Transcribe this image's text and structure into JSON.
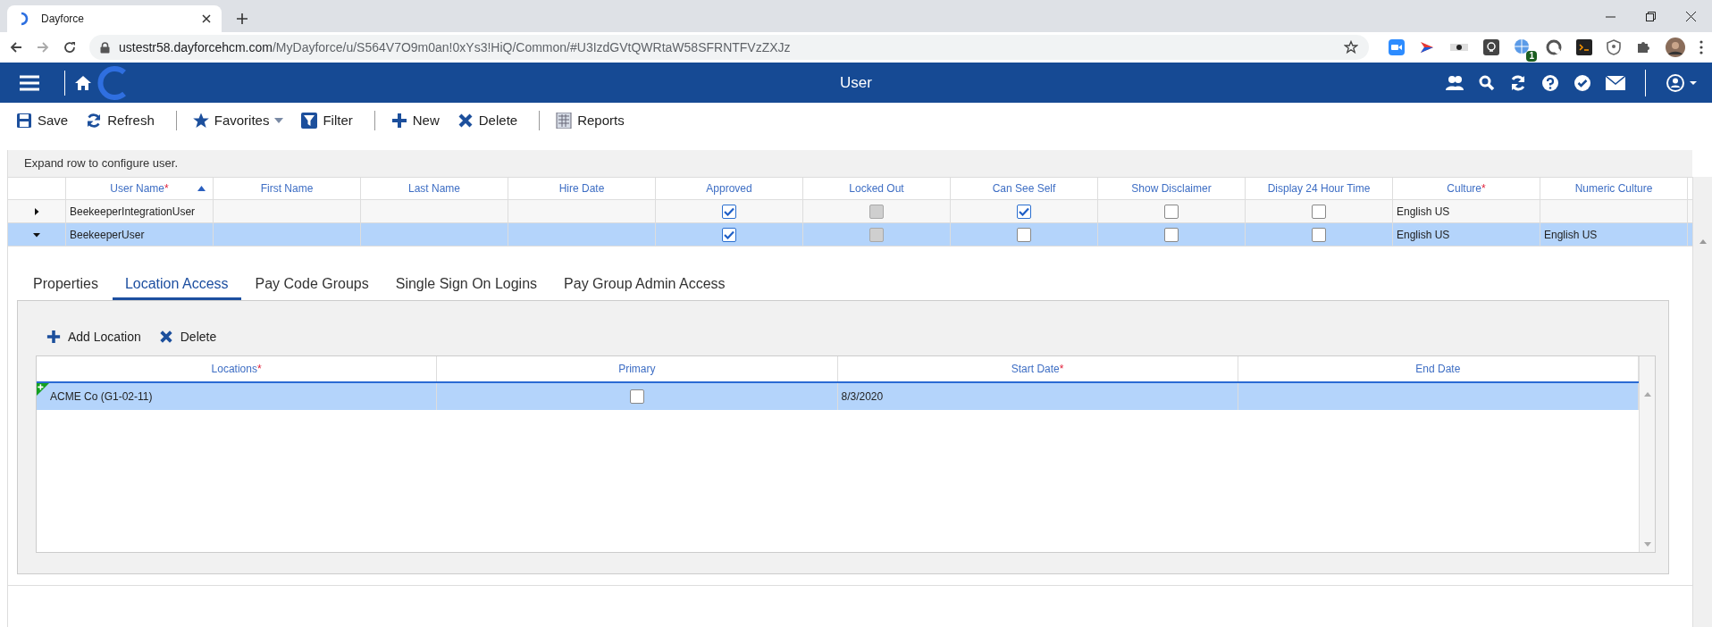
{
  "browser": {
    "tab_title": "Dayforce",
    "url_host": "ustestr58.dayforcehcm.com",
    "url_path": "/MyDayforce/u/S564V7O9m0an!0xYs3!HiQ/Common/#U3IzdGVtQWRtaW58SFRNTFVzZXJz",
    "extension_badge": "1"
  },
  "app": {
    "title": "User"
  },
  "toolbar": [
    {
      "kind": "save",
      "label": "Save"
    },
    {
      "kind": "refresh",
      "label": "Refresh"
    },
    {
      "kind": "separator"
    },
    {
      "kind": "favorites",
      "label": "Favorites"
    },
    {
      "kind": "filter",
      "label": "Filter"
    },
    {
      "kind": "separator"
    },
    {
      "kind": "new",
      "label": "New"
    },
    {
      "kind": "delete",
      "label": "Delete"
    },
    {
      "kind": "separator"
    },
    {
      "kind": "reports",
      "label": "Reports"
    }
  ],
  "hint": "Expand row to configure user.",
  "grid": {
    "columns": [
      {
        "label": "User Name",
        "required_mark": "*",
        "sorted": true
      },
      {
        "label": "First Name"
      },
      {
        "label": "Last Name"
      },
      {
        "label": "Hire Date"
      },
      {
        "label": "Approved"
      },
      {
        "label": "Locked Out"
      },
      {
        "label": "Can See Self"
      },
      {
        "label": "Show Disclaimer"
      },
      {
        "label": "Display 24 Hour Time"
      },
      {
        "label": "Culture",
        "required_mark": "*"
      },
      {
        "label": "Numeric Culture"
      }
    ],
    "rows": [
      {
        "expanded": false,
        "selected": false,
        "cells": [
          {
            "kind": "text",
            "text": "BeekeeperIntegrationUser"
          },
          {
            "kind": "empty"
          },
          {
            "kind": "empty"
          },
          {
            "kind": "empty"
          },
          {
            "kind": "checkbox",
            "checked": true,
            "disabled": false
          },
          {
            "kind": "checkbox",
            "checked": false,
            "disabled": true
          },
          {
            "kind": "checkbox",
            "checked": true,
            "disabled": false
          },
          {
            "kind": "checkbox",
            "checked": false,
            "disabled": false
          },
          {
            "kind": "checkbox",
            "checked": false,
            "disabled": false
          },
          {
            "kind": "text",
            "text": "English US"
          },
          {
            "kind": "empty"
          }
        ]
      },
      {
        "expanded": true,
        "selected": true,
        "cells": [
          {
            "kind": "text",
            "text": "BeekeeperUser"
          },
          {
            "kind": "empty"
          },
          {
            "kind": "empty"
          },
          {
            "kind": "empty"
          },
          {
            "kind": "checkbox",
            "checked": true,
            "disabled": false
          },
          {
            "kind": "checkbox",
            "checked": false,
            "disabled": true
          },
          {
            "kind": "checkbox",
            "checked": false,
            "disabled": false
          },
          {
            "kind": "checkbox",
            "checked": false,
            "disabled": false
          },
          {
            "kind": "checkbox",
            "checked": false,
            "disabled": false
          },
          {
            "kind": "text",
            "text": "English US"
          },
          {
            "kind": "text",
            "text": "English US"
          }
        ]
      }
    ]
  },
  "detail_tabs": [
    {
      "label": "Properties",
      "selected": false
    },
    {
      "label": "Location Access",
      "selected": true
    },
    {
      "label": "Pay Code Groups",
      "selected": false
    },
    {
      "label": "Single Sign On Logins",
      "selected": false
    },
    {
      "label": "Pay Group Admin Access",
      "selected": false
    }
  ],
  "detail_toolbar": [
    {
      "kind": "new",
      "label": "Add Location"
    },
    {
      "kind": "delete",
      "label": "Delete"
    }
  ],
  "locations": {
    "columns": [
      {
        "label": "Locations",
        "required_mark": "*"
      },
      {
        "label": "Primary"
      },
      {
        "label": "Start Date",
        "required_mark": "*"
      },
      {
        "label": "End Date"
      }
    ],
    "rows": [
      {
        "selected": true,
        "is_new": true,
        "cells": [
          {
            "kind": "text",
            "text": "ACME Co (G1-02-11)"
          },
          {
            "kind": "checkbox",
            "checked": false,
            "disabled": false
          },
          {
            "kind": "text",
            "text": "8/3/2020"
          },
          {
            "kind": "empty"
          }
        ]
      }
    ]
  }
}
